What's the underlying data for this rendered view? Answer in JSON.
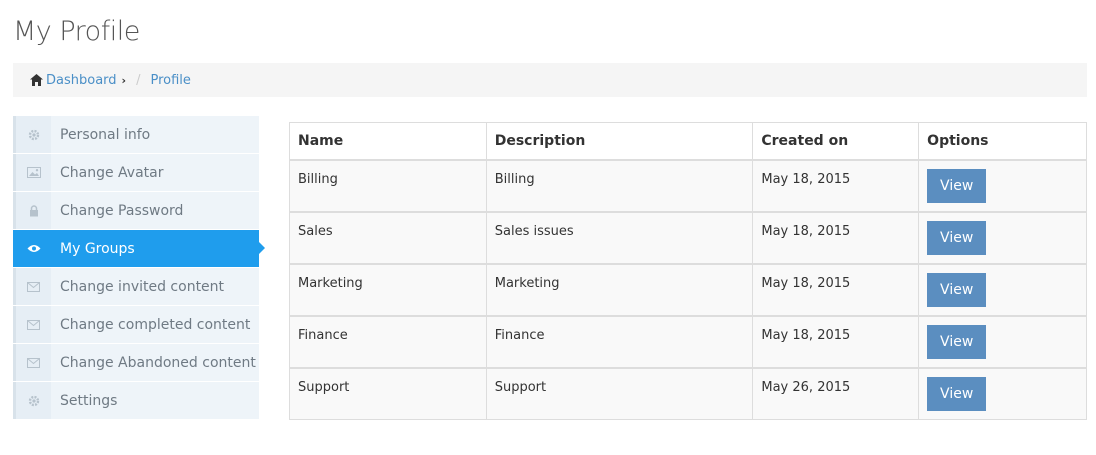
{
  "page": {
    "title": "My Profile"
  },
  "breadcrumb": {
    "home": "Dashboard",
    "chevron": "›",
    "separator": "/",
    "current": "Profile"
  },
  "sidebar": {
    "items": [
      {
        "label": "Personal info",
        "icon": "gear-icon"
      },
      {
        "label": "Change Avatar",
        "icon": "image-icon"
      },
      {
        "label": "Change Password",
        "icon": "lock-icon"
      },
      {
        "label": "My Groups",
        "icon": "eye-icon",
        "active": true
      },
      {
        "label": "Change invited content",
        "icon": "envelope-icon"
      },
      {
        "label": "Change completed content",
        "icon": "envelope-icon"
      },
      {
        "label": "Change Abandoned content",
        "icon": "envelope-icon"
      },
      {
        "label": "Settings",
        "icon": "gear-icon"
      }
    ]
  },
  "table": {
    "headers": [
      "Name",
      "Description",
      "Created on",
      "Options"
    ],
    "rows": [
      {
        "name": "Billing",
        "description": "Billing",
        "created": "May 18, 2015",
        "action": "View"
      },
      {
        "name": "Sales",
        "description": "Sales issues",
        "created": "May 18, 2015",
        "action": "View"
      },
      {
        "name": "Marketing",
        "description": "Marketing",
        "created": "May 18, 2015",
        "action": "View"
      },
      {
        "name": "Finance",
        "description": "Finance",
        "created": "May 18, 2015",
        "action": "View"
      },
      {
        "name": "Support",
        "description": "Support",
        "created": "May 26, 2015",
        "action": "View"
      }
    ]
  },
  "colors": {
    "accent": "#1f9ded",
    "button": "#5b8ec0",
    "link": "#4a8fc7"
  }
}
